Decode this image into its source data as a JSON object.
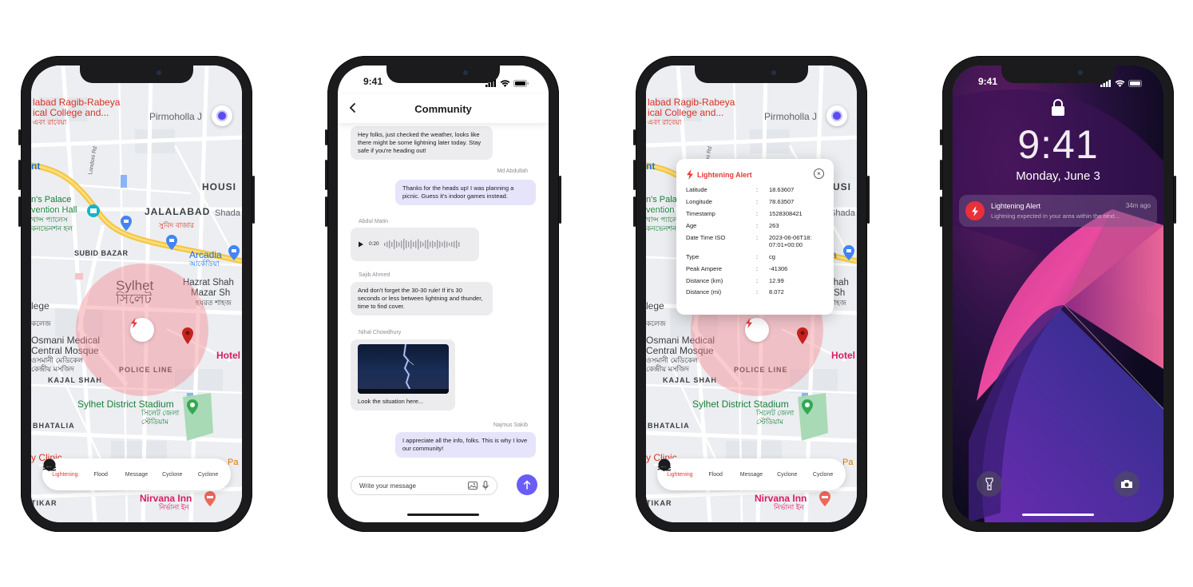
{
  "tabs": [
    {
      "label": "Lightening",
      "icon": "lightning-icon",
      "active": true
    },
    {
      "label": "Flood",
      "icon": "flood-icon",
      "active": false
    },
    {
      "label": "Message",
      "icon": "message-icon",
      "active": false
    },
    {
      "label": "Cyclone",
      "icon": "cyclone-icon",
      "active": false
    },
    {
      "label": "Cyclone",
      "icon": "storm-icon",
      "active": false
    }
  ],
  "map": {
    "labels": {
      "college1": "labad Ragib-Rabeya",
      "college2": "ical College and...",
      "college_bn": "এবং রাবেয়া",
      "pirmoholla": "Pirmoholla J",
      "housing": "HOUSI",
      "shada": "Shada",
      "palace1": "n's Palace",
      "palace2": "vention Hall",
      "palace_bn1": "খান্স প্যালেস",
      "palace_bn2": "কনভেনশন হল",
      "jalalabad": "JALALABAD",
      "bazar_bn": "সুবিদ বাজার",
      "londoni": "Londoni Rd",
      "subid": "SUBID BAZAR",
      "arcadia": "Arcadia",
      "arcadia_bn": "আর্কেডিয়া",
      "sylhet": "Sylhet",
      "sylhet_bn": "সিলেট",
      "hazrat1": "Hazrat Shah",
      "hazrat2": "Mazar Sh",
      "hazrat_bn": "হযরত শাহজ",
      "lege": "lege",
      "lege_bn": "কলেজ",
      "osmani1": "Osmani Medical",
      "osmani2": "Central Mosque",
      "osmani_bn1": "ওসমানী মেডিকেল",
      "osmani_bn2": "কেন্দ্রীয় মসজিদ",
      "police": "POLICE LINE",
      "kajal": "KAJAL SHAH",
      "hotel": "Hotel",
      "stadium": "Sylhet District Stadium",
      "stadium_bn1": "সিলেট জেলা",
      "stadium_bn2": "স্টেডিয়াম",
      "bhatalia": "BHATALIA",
      "clinic": "y Clinic",
      "par": "Pa",
      "tikar": "TIKAR",
      "nirvana": "Nirvana Inn",
      "nirvana_bn": "নির্ভানা ইন",
      "ent": "nt"
    }
  },
  "chat": {
    "time": "9:41",
    "title": "Community",
    "messages": {
      "m1": "Hey folks, just checked the weather, looks like there might be some lightning later today. Stay safe if you're heading out!",
      "s2": "Md Abdullah",
      "m2": "Thanks for the heads up! I was planning a picnic. Guess it's indoor games instead.",
      "s3": "Abdul Matin",
      "m3_duration": "0:20",
      "s4": "Sajib Ahmed",
      "m4": "And don't forget the 30-30 rule! If it's 30 seconds or less between lightning and thunder, time to find cover.",
      "s5": "Nihal Chowdhury",
      "m5": "Look the situation here...",
      "s6": "Najmus Sakib",
      "m6": "I appreciate all the info, folks. This is why I love our community!"
    },
    "composer_placeholder": "Write your message"
  },
  "alert": {
    "title": "Lightening Alert",
    "rows": [
      {
        "key": "Latitude",
        "value": "18.63607"
      },
      {
        "key": "Longitude",
        "value": "78.63507"
      },
      {
        "key": "Timestamp",
        "value": "1528308421"
      },
      {
        "key": "Age",
        "value": "263"
      },
      {
        "key": "Date Time ISO",
        "value": "2023-06-06T18:\n07:01+00:00"
      },
      {
        "key": "Type",
        "value": "cg"
      },
      {
        "key": "Peak Ampere",
        "value": "-41306"
      },
      {
        "key": "Distance (km)",
        "value": "12.99"
      },
      {
        "key": "Distance (mi)",
        "value": "8.072"
      }
    ],
    "separator": ":"
  },
  "lock": {
    "status_time": "9:41",
    "time": "9:41",
    "date": "Monday, June 3",
    "notification": {
      "title": "Lightening Alert",
      "time": "34m ago",
      "text": "Lightning expected in your area within the next..."
    }
  },
  "colors": {
    "accent": "#6b5cf6",
    "alert_red": "#e53935",
    "zone": "#f4828c"
  }
}
